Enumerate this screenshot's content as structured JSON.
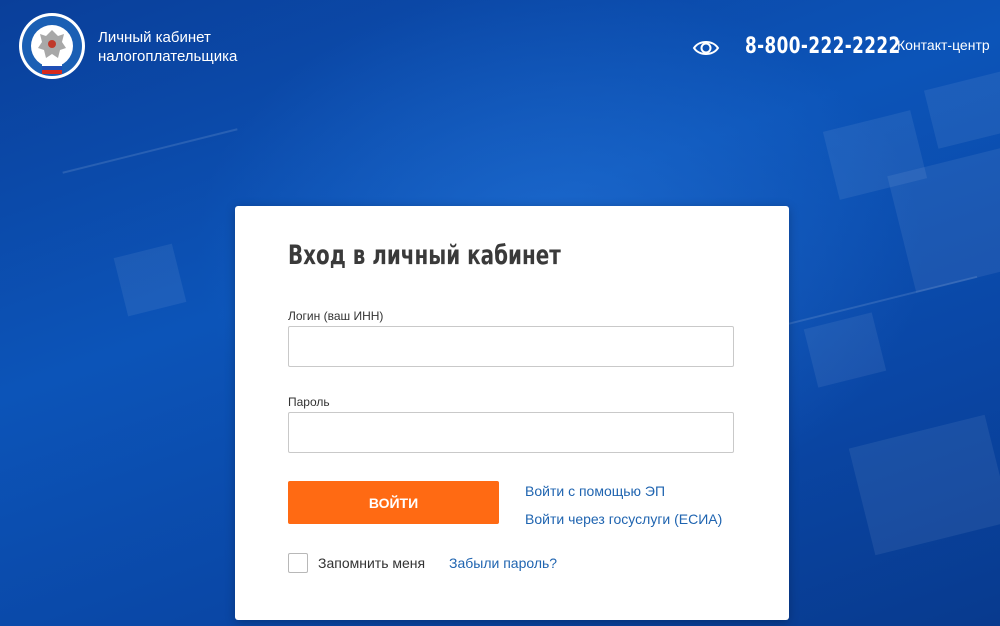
{
  "header": {
    "brand_line1": "Личный кабинет",
    "brand_line2": "налогоплательщика",
    "logo_icon": "fns-emblem-icon",
    "accessibility_icon": "eye-icon",
    "phone": "8-800-222-2222",
    "contact_center": "Контакт-центр"
  },
  "login": {
    "title": "Вход в личный кабинет",
    "login_label": "Логин (ваш ИНН)",
    "login_value": "",
    "password_label": "Пароль",
    "password_value": "",
    "submit_label": "ВОЙТИ",
    "ep_link": "Войти с помощью ЭП",
    "esia_link": "Войти через госуслуги (ЕСИА)",
    "remember_label": "Запомнить меня",
    "remember_checked": false,
    "forgot_link": "Забыли пароль?"
  },
  "colors": {
    "background": "#0c54b8",
    "accent_button": "#ff6a13",
    "link": "#1f64b0"
  }
}
